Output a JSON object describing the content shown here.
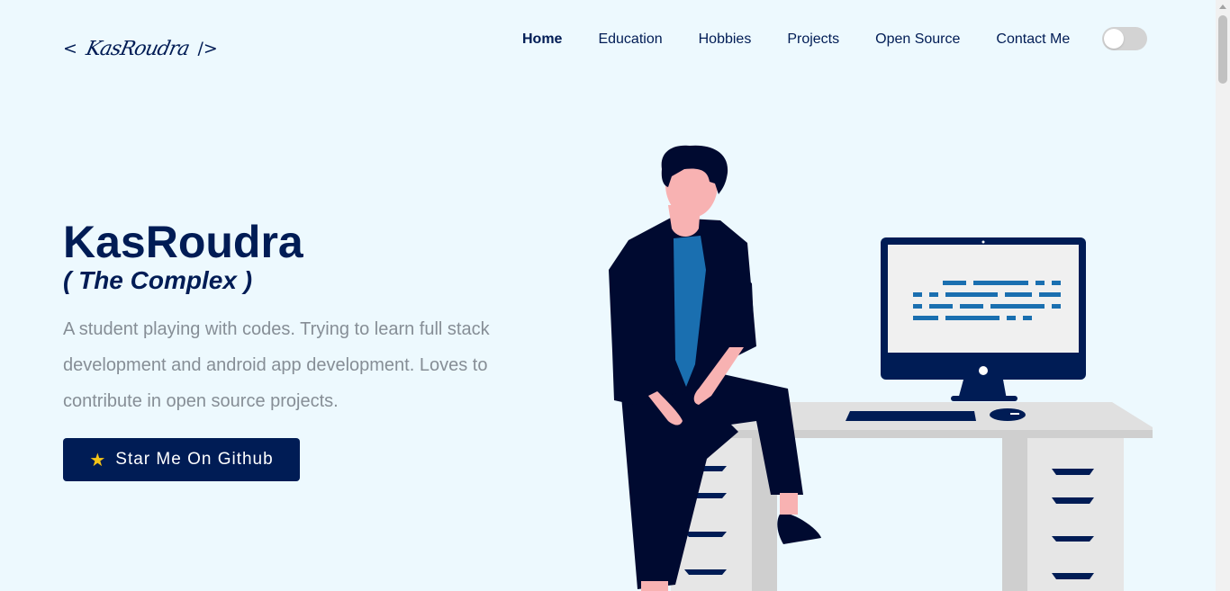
{
  "header": {
    "logo_open": "<",
    "logo_signature": "KasRoudra",
    "logo_close": "/>",
    "nav": [
      {
        "label": "Home",
        "active": true
      },
      {
        "label": "Education",
        "active": false
      },
      {
        "label": "Hobbies",
        "active": false
      },
      {
        "label": "Projects",
        "active": false
      },
      {
        "label": "Open Source",
        "active": false
      },
      {
        "label": "Contact Me",
        "active": false
      }
    ],
    "theme_toggle": {
      "state": "off",
      "icon": "toggle-switch"
    }
  },
  "hero": {
    "title": "KasRoudra",
    "subtitle": "( The Complex )",
    "description": "A student playing with codes. Trying to learn full stack development and android app development. Loves to contribute in open source projects.",
    "cta_icon": "★",
    "cta_label": "Star Me On Github"
  },
  "illustration": {
    "icon": "developer-at-desk-illustration"
  },
  "colors": {
    "background": "#edf9fe",
    "primary": "#001c55",
    "muted_text": "#868e96",
    "accent_blue": "#1a6fb0"
  }
}
